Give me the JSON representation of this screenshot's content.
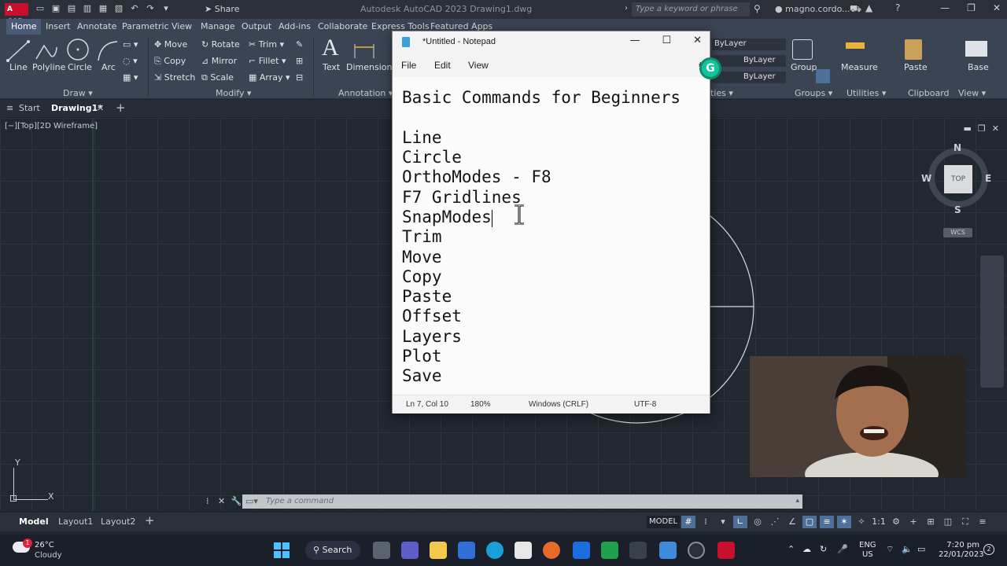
{
  "autocad": {
    "logo": "A CAD",
    "share": "Share",
    "title": "Autodesk AutoCAD 2023    Drawing1.dwg",
    "search_placeholder": "Type a keyword or phrase",
    "user": "magno.cordo...",
    "ribbon_tabs": [
      "Home",
      "Insert",
      "Annotate",
      "Parametric",
      "View",
      "Manage",
      "Output",
      "Add-ins",
      "Collaborate",
      "Express Tools",
      "Featured Apps"
    ],
    "draw": {
      "line": "Line",
      "polyline": "Polyline",
      "circle": "Circle",
      "arc": "Arc",
      "label": "Draw"
    },
    "modify": {
      "move": "Move",
      "rotate": "Rotate",
      "trim": "Trim",
      "copy": "Copy",
      "mirror": "Mirror",
      "fillet": "Fillet",
      "stretch": "Stretch",
      "scale": "Scale",
      "array": "Array",
      "label": "Modify"
    },
    "annotation": {
      "text": "Text",
      "dimension": "Dimension",
      "label": "Annotation"
    },
    "properties": {
      "bylayer1": "ByLayer",
      "bylayer2": "ByLayer",
      "bylayer3": "ByLayer",
      "label": "ties"
    },
    "groups": {
      "group": "Group",
      "label": "Groups"
    },
    "utilities": {
      "measure": "Measure",
      "label": "Utilities"
    },
    "clipboard": {
      "paste": "Paste",
      "label": "Clipboard"
    },
    "view_panel": {
      "base": "Base",
      "label": "View"
    },
    "file_tabs": {
      "start": "Start",
      "drawing": "Drawing1*",
      "add": "+"
    },
    "viewport_label": "[−][Top][2D Wireframe]",
    "viewcube": {
      "top": "TOP",
      "n": "N",
      "s": "S",
      "e": "E",
      "w": "W",
      "wcs": "WCS"
    },
    "ucs": {
      "y": "Y",
      "x": "X"
    },
    "command_placeholder": "Type a command",
    "layout_tabs": [
      "Model",
      "Layout1",
      "Layout2"
    ],
    "layout_add": "+",
    "model_button": "MODEL",
    "scale": "1:1"
  },
  "notepad": {
    "title": "*Untitled - Notepad",
    "menu": [
      "File",
      "Edit",
      "View"
    ],
    "lines": [
      "Basic Commands for Beginners",
      "",
      "Line",
      "Circle",
      "OrthoModes - F8",
      "F7 Gridlines",
      "SnapModes",
      "Trim",
      "Move",
      "Copy",
      "Paste",
      "Offset",
      "Layers",
      "Plot",
      "Save"
    ],
    "status": {
      "position": "Ln 7, Col 10",
      "zoom": "180%",
      "line_ending": "Windows (CRLF)",
      "encoding": "UTF-8"
    }
  },
  "grammarly": "G",
  "taskbar": {
    "weather_badge": "1",
    "temperature": "26°C",
    "weather": "Cloudy",
    "search": "Search",
    "lang_1": "ENG",
    "lang_2": "US",
    "time": "7:20 pm",
    "date": "22/01/2023",
    "notifications": "2"
  },
  "colors": {
    "autocad_bg": "#212830",
    "ribbon": "#3b4453",
    "notepad_bg": "#fbfbfb",
    "accent": "#4e6f98",
    "grammarly": "#15c39a",
    "autocad_red": "#c8102e"
  }
}
